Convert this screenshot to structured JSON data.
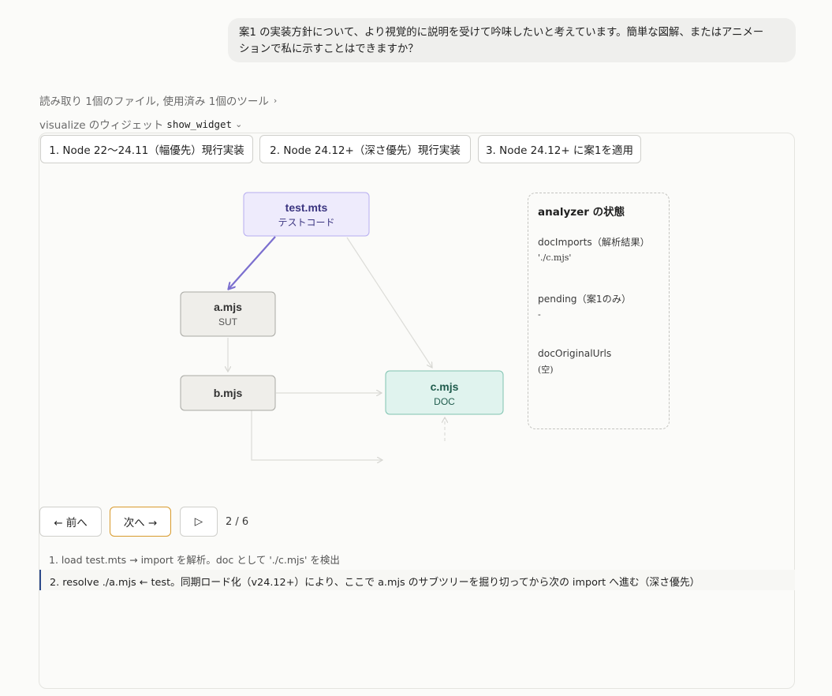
{
  "user_message": {
    "line1": "案1 の実装方針について、より視覚的に説明を受けて吟味したいと考えています。簡単な図解、またはアニメー",
    "line2": "ションで私に示すことはできますか？"
  },
  "meta": {
    "summary": "読み取り 1個のファイル, 使用済み 1個のツール",
    "widget_prefix": "visualize のウィジェット",
    "widget_name": "show_widget"
  },
  "tabs": [
    {
      "label": "1. Node 22〜24.11（幅優先）現行実装"
    },
    {
      "label": "2. Node 24.12+（深さ優先）現行実装"
    },
    {
      "label": "3. Node 24.12+ に案1を適用"
    }
  ],
  "nodes": {
    "test": {
      "title": "test.mts",
      "sub": "テストコード"
    },
    "a": {
      "title": "a.mjs",
      "sub": "SUT"
    },
    "b": {
      "title": "b.mjs"
    },
    "c": {
      "title": "c.mjs",
      "sub": "DOC"
    }
  },
  "state": {
    "title": "analyzer の状態",
    "items": [
      {
        "label": "docImports（解析結果）",
        "value": "'./c.mjs'"
      },
      {
        "label": "pending（案1のみ）",
        "value": "-"
      },
      {
        "label": "docOriginalUrls",
        "value": "(空)"
      }
    ]
  },
  "controls": {
    "prev": "← 前へ",
    "next": "次へ →",
    "play": "▷",
    "counter": "2 / 6"
  },
  "log": [
    "1. load test.mts → import を解析。doc として './c.mjs' を検出",
    "2. resolve ./a.mjs ← test。同期ロード化（v24.12+）により、ここで a.mjs のサブツリーを掘り切ってから次の import へ進む（深さ優先）"
  ],
  "colors": {
    "test_fill": "#eeebfc",
    "test_stroke": "#b7aef0",
    "test_text": "#3b3580",
    "neutral_fill": "#efeeea",
    "neutral_stroke": "#a9a9a4",
    "doc_fill": "#e0f3ee",
    "doc_stroke": "#7fc3b0",
    "doc_text": "#1f5b4c",
    "active_edge": "#7b6fcf",
    "faint_edge": "#dcdcd8",
    "next_border": "#d89a2c",
    "log_marker": "#2c4a8a"
  }
}
